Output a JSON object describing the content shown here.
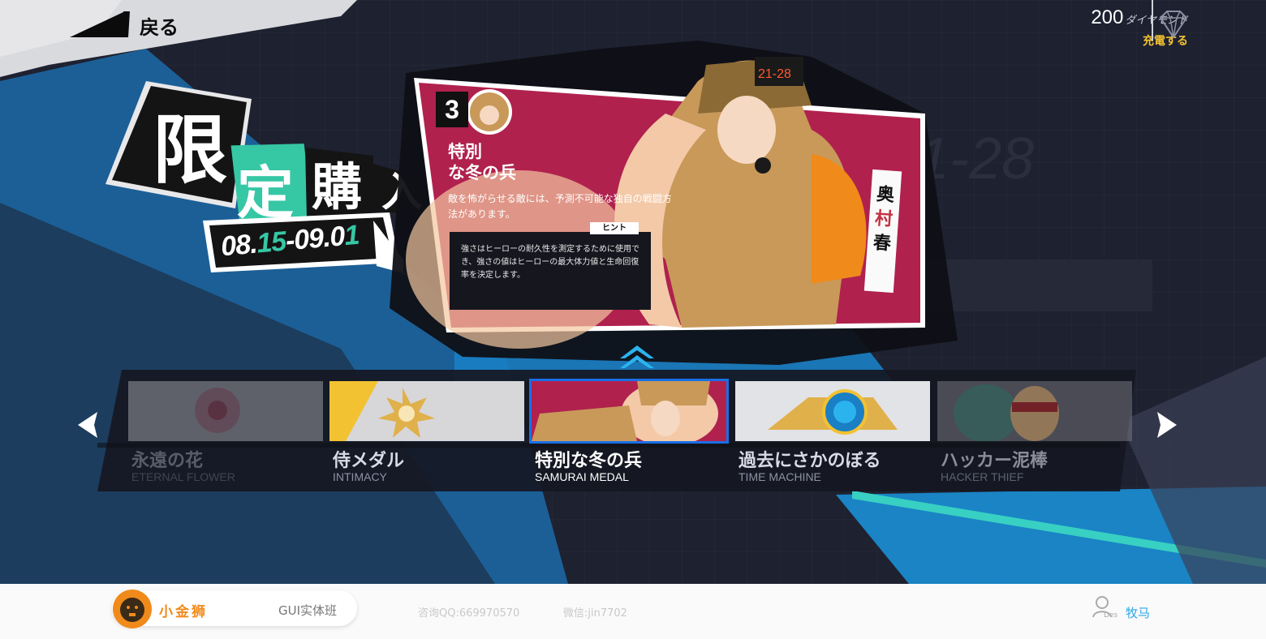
{
  "header": {
    "back_label": "戻る",
    "currency_amount": "200",
    "currency_name": "ダイヤモンド",
    "recharge_label": "充電する",
    "currency_icon": "diamond-icon"
  },
  "promo": {
    "title_chars": [
      "限",
      "定",
      "購",
      "入"
    ],
    "date_start_prefix": "08.",
    "date_start_highlight": "15",
    "date_mid": "-09.0",
    "date_end_highlight": "1"
  },
  "card": {
    "number": "3",
    "title": "特別\nな冬の兵",
    "description": "敵を怖がらせる敵には、予測不可能な独自の戦闘方法があります。",
    "hint_label": "ヒント",
    "hint_text": "強さはヒーローの耐久性を測定するために使用でき、強さの値はヒーローの最大体力値と生命回復率を決定します。",
    "character_name_chars": [
      "奥",
      "村",
      "春"
    ],
    "badge_text": "21-28"
  },
  "items": [
    {
      "name": "永遠の花",
      "subtitle": "ETERNAL FLOWER",
      "selected": false
    },
    {
      "name": "侍メダル",
      "subtitle": "INTIMACY",
      "selected": false
    },
    {
      "name": "特別な冬の兵",
      "subtitle": "SAMURAI MEDAL",
      "selected": true
    },
    {
      "name": "過去にさかのぼる",
      "subtitle": "TIME MACHINE",
      "selected": false
    },
    {
      "name": "ハッカー泥棒",
      "subtitle": "HACKER THIEF",
      "selected": false
    }
  ],
  "footer": {
    "brand": "小金狮",
    "course": "GUI实体班",
    "qq": "咨询QQ:669970570",
    "wechat": "微信:jin7702",
    "user_tag": "Des",
    "user_name": "牧马"
  },
  "colors": {
    "accent_teal": "#36c7a5",
    "accent_blue": "#1a8fd6",
    "card_magenta": "#b0214e",
    "recharge_gold": "#f2c232",
    "brand_orange": "#f08a1a"
  }
}
